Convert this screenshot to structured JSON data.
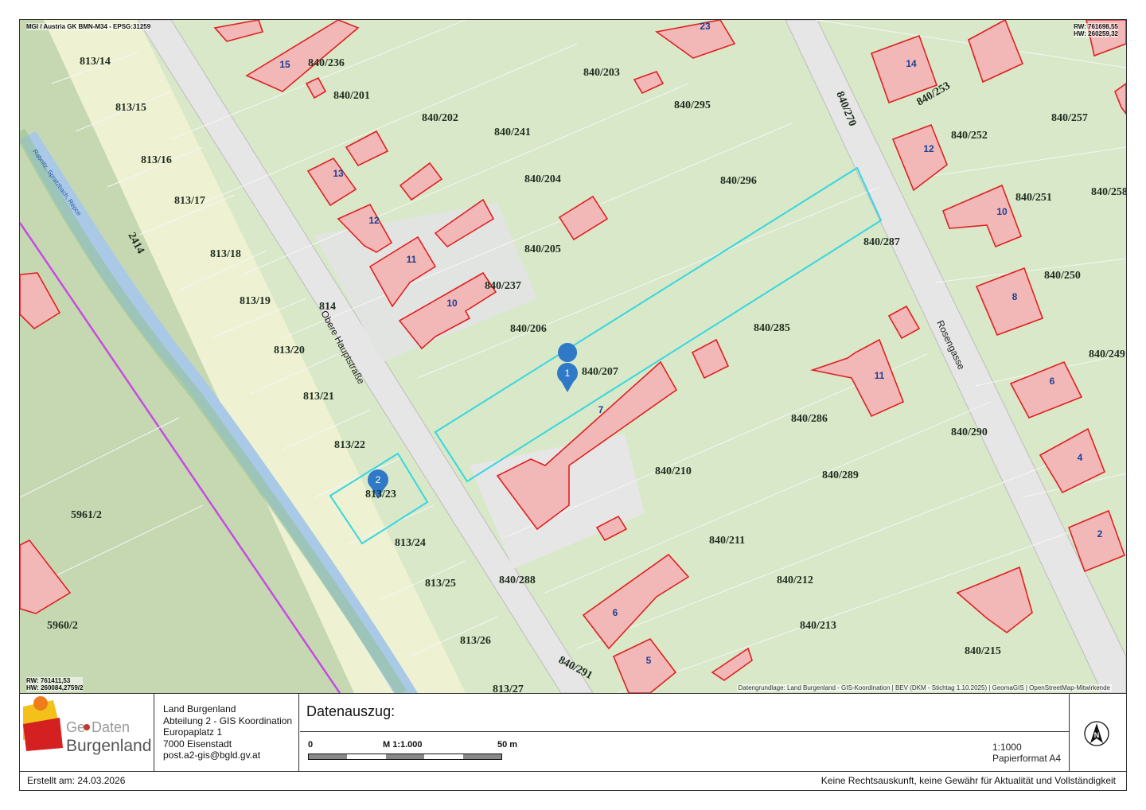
{
  "map": {
    "crs_label": "MGI / Austria GK BMN-M34 - EPSG:31259",
    "top_right_coords": [
      "RW: 761698,55",
      "HW: 260259,32"
    ],
    "bottom_left_coords": [
      "RW: 761411,53",
      "HW: 260084,2759/2"
    ],
    "attribution": "Datengrundlage: Land Burgenland - GIS-Koordination | BEV (DKM - Stichtag 1.10.2025) | GeomaGIS | OpenStreetMap-Mitwirkende",
    "street_names": [
      "Obere Hauptstraße",
      "Rosengasse",
      "Rabnitz, Spratzbach, Répce"
    ],
    "markers": [
      {
        "label": "1"
      },
      {
        "label": "2"
      }
    ],
    "parcel_labels": [
      "813/14",
      "813/15",
      "813/16",
      "813/17",
      "813/18",
      "813/19",
      "813/20",
      "813/21",
      "813/22",
      "813/23",
      "813/24",
      "813/25",
      "813/26",
      "813/27",
      "814",
      "2414",
      "5961/2",
      "5960/2",
      "840/236",
      "840/201",
      "840/202",
      "840/241",
      "840/203",
      "840/295",
      "840/204",
      "840/296",
      "840/205",
      "840/237",
      "840/206",
      "840/207",
      "840/287",
      "840/270",
      "840/253",
      "840/257",
      "840/252",
      "840/251",
      "840/258",
      "840/250",
      "840/249",
      "840/285",
      "840/286",
      "840/290",
      "840/210",
      "840/289",
      "840/211",
      "840/212",
      "840/213",
      "840/215",
      "840/288",
      "840/291"
    ],
    "house_numbers": [
      "15",
      "23",
      "14",
      "13",
      "12",
      "11",
      "10",
      "7",
      "6",
      "5",
      "11",
      "12",
      "10",
      "8",
      "6",
      "4",
      "2"
    ],
    "colors": {
      "background": "#d8e8c8",
      "building_fill": "#f2b8b8",
      "building_stroke": "#e02020",
      "selection": "#37d6e0",
      "marker": "#2f79c7",
      "boundary": "#c44de0",
      "river": "#9fc3e8"
    }
  },
  "footer": {
    "logo_text_1": "Ge",
    "logo_text_2": "Daten",
    "logo_text_3": "Burgenland",
    "address": [
      "Land Burgenland",
      "Abteilung 2 - GIS Koordination",
      "Europaplatz 1",
      "7000 Eisenstadt",
      "post.a2-gis@bgld.gv.at"
    ],
    "title": "Datenauszug:",
    "scale_start": "0",
    "scale_mid": "M 1:1.000",
    "scale_end": "50 m",
    "scale_ratio": "1:1000",
    "paper_format": "Papierformat A4",
    "created": "Erstellt am: 24.03.2026",
    "disclaimer": "Keine Rechtsauskunft, keine Gewähr für Aktualität und Vollständigkeit"
  }
}
